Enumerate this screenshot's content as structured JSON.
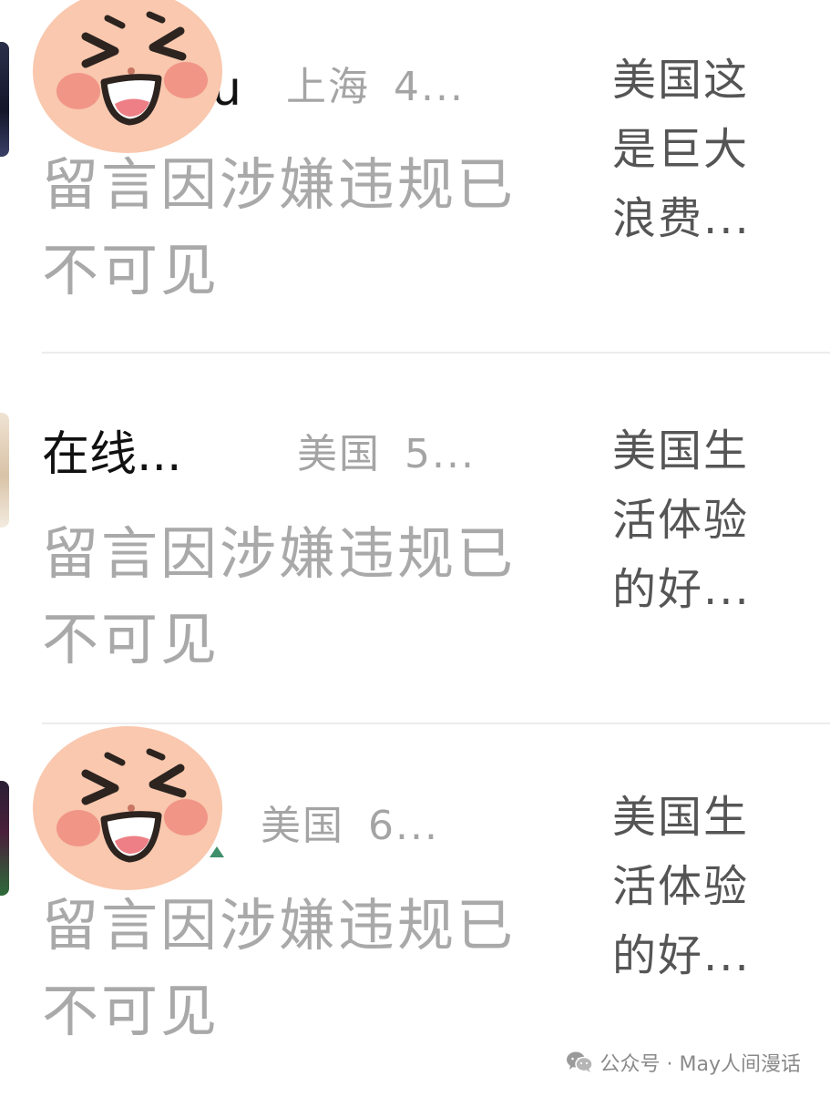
{
  "comments": [
    {
      "name_visible": "u",
      "location": "上海",
      "time_truncated": "4...",
      "content": "留言因涉嫌违规已不可见",
      "article_lines": [
        "美国这",
        "是巨大",
        "浪费..."
      ]
    },
    {
      "name_visible": "在线...",
      "location": "美国",
      "time_truncated": "5...",
      "content": "留言因涉嫌违规已不可见",
      "article_lines": [
        "美国生",
        "活体验",
        "的好..."
      ]
    },
    {
      "name_visible": "",
      "location": "美国",
      "time_truncated": "6...",
      "content": "留言因涉嫌违规已不可见",
      "article_lines": [
        "美国生",
        "活体验",
        "的好..."
      ]
    }
  ],
  "stickers": {
    "icon": "laughing-face-sticker-icon",
    "skin_color": "#f9c8ae",
    "cheek_color": "#f08c80",
    "outline_color": "#2d2420"
  },
  "colors": {
    "comment_gray": "#a9a9a9",
    "meta_gray": "#a4a4a4",
    "name_black": "#111111",
    "title_gray": "#555555",
    "divider": "#ececec"
  },
  "watermark": {
    "text": "公众号 · May人间漫话",
    "icon": "wechat-icon"
  }
}
